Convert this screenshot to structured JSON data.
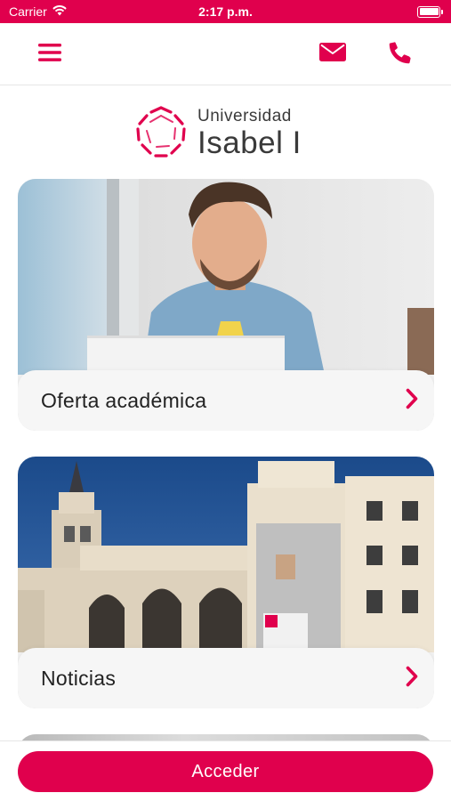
{
  "status_bar": {
    "carrier": "Carrier",
    "time": "2:17 p.m.",
    "icons": [
      "wifi-icon",
      "battery-icon"
    ]
  },
  "nav": {
    "icons": [
      "hamburger-menu-icon",
      "mail-icon",
      "phone-icon"
    ]
  },
  "logo": {
    "line1": "Universidad",
    "line2": "Isabel I"
  },
  "cards": [
    {
      "label": "Oferta académica",
      "icon": "chevron-right-icon"
    },
    {
      "label": "Noticias",
      "icon": "chevron-right-icon"
    }
  ],
  "bottom": {
    "access_label": "Acceder"
  },
  "colors": {
    "brand": "#e0004d",
    "text": "#222222",
    "card_bg": "#f6f6f6"
  }
}
